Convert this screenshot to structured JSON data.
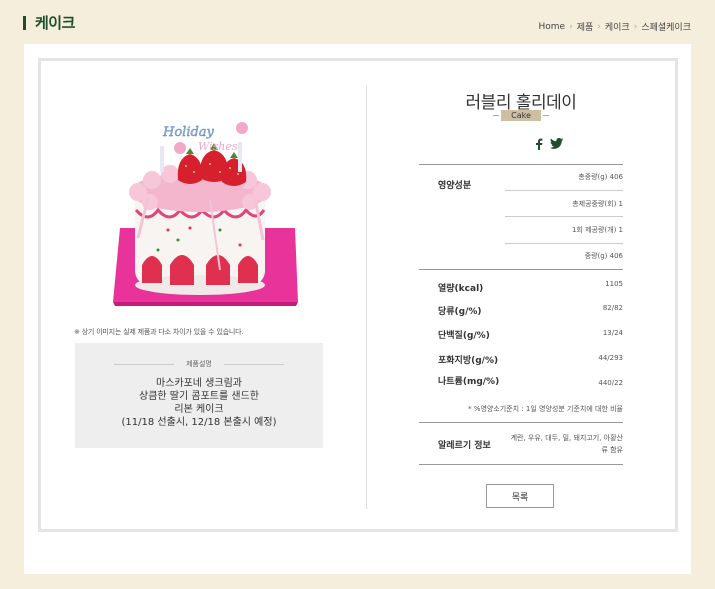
{
  "header": {
    "title": "케이크",
    "breadcrumb": [
      "Home",
      "제품",
      "케이크",
      "스페셜케이크"
    ]
  },
  "product": {
    "name": "러블리 홀리데이",
    "category": "Cake",
    "image_notice": "※ 상기 이미지는 실제 제품과 다소 차이가 있을 수 있습니다.",
    "topper_text": "Holiday Wishes",
    "description_heading": "제품설명",
    "description": "마스카포네 생크림과\n상큼한 딸기 콤포트를 샌드한\n리본 케이크\n(11/18 선출시, 12/18 본출시 예정)"
  },
  "nutrition": {
    "section_label": "영양성분",
    "sizes": [
      "총중량(g) 406",
      "총제공중량(회) 1",
      "1회 제공량(개) 1",
      "중량(g) 406"
    ],
    "rows": [
      {
        "label": "열량(kcal)",
        "value": "1105"
      },
      {
        "label": "당류(g/%)",
        "value": "82/82"
      },
      {
        "label": "단백질(g/%)",
        "value": "13/24"
      },
      {
        "label": "포화지방(g/%)",
        "value": "44/293"
      },
      {
        "label": "나트륨(mg/%)",
        "value": "440/22"
      }
    ],
    "note": "* %영양소기준치 : 1일 영양성분 기준치에 대한 비율"
  },
  "allergen": {
    "label": "알레르기 정보",
    "value": "계란, 우유, 대두, 밀, 돼지고기, 아황산류 함유"
  },
  "buttons": {
    "list_label": "목록"
  },
  "social": {
    "icons": [
      "facebook-icon",
      "twitter-icon"
    ]
  },
  "colors": {
    "background": "#f5eedc",
    "brand_green": "#1f4d2e",
    "category_badge": "#cdbfa3",
    "desc_box": "#eeeeee"
  }
}
